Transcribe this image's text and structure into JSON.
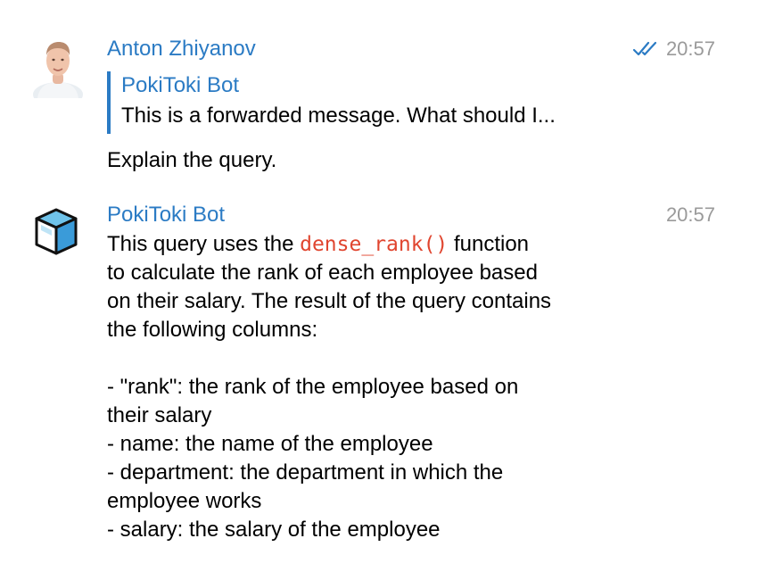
{
  "messages": [
    {
      "sender": "Anton Zhiyanov",
      "time": "20:57",
      "read_status": "double-check-icon",
      "forwarded": {
        "from": "PokiToki Bot",
        "text": "This is a forwarded message. What should I..."
      },
      "text": "Explain the query."
    },
    {
      "sender": "PokiToki Bot",
      "time": "20:57",
      "avatar_icon": "cube-icon",
      "intro_before": "This query uses the",
      "intro_code": "dense_rank()",
      "intro_after": "function",
      "intro_lines": [
        "to calculate the rank of each employee based",
        "on their salary. The result of the query contains",
        "the following columns:"
      ],
      "list_lines": [
        "- \"rank\": the rank of the employee based on",
        "their salary",
        "- name: the name of the employee",
        "- department: the department in which the",
        "employee works",
        "- salary: the salary of the employee"
      ]
    }
  ],
  "colors": {
    "accent": "#2b7bc4",
    "code": "#e0452f",
    "timestamp": "#9a9a9a"
  }
}
